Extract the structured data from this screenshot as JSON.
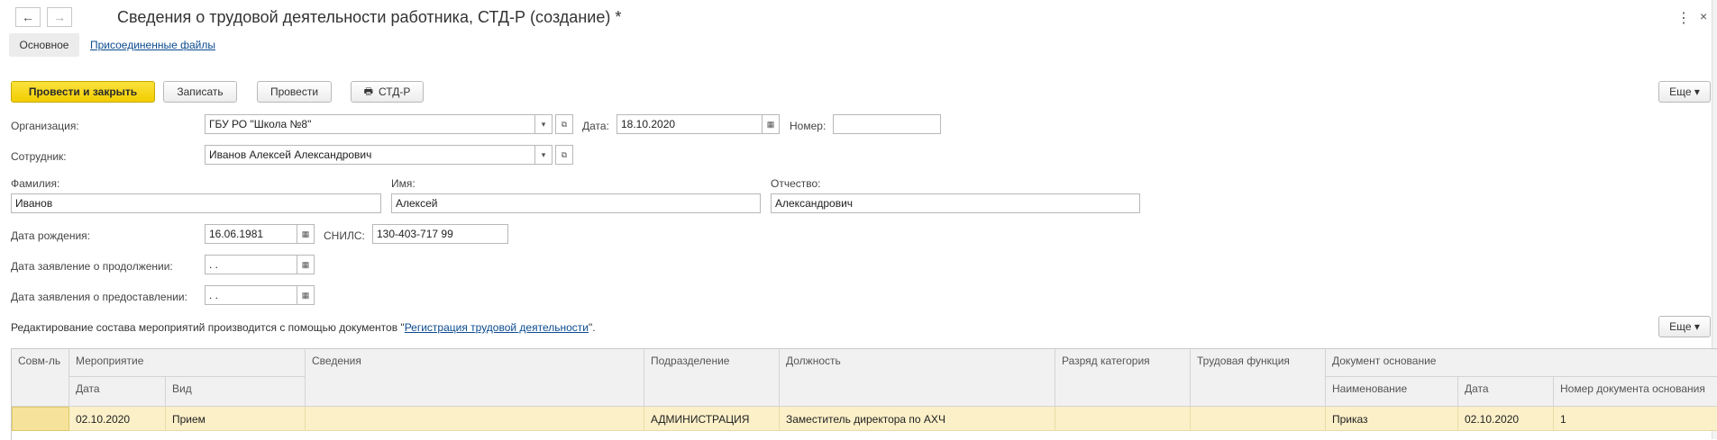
{
  "window": {
    "title": "Сведения о трудовой деятельности работника, СТД-Р (создание) *",
    "nav_back": "←",
    "nav_forward": "→",
    "menu_icon": "⋮",
    "close_icon": "×"
  },
  "tabs": {
    "main": "Основное",
    "attached": "Присоединенные файлы"
  },
  "toolbar": {
    "post_close": "Провести и закрыть",
    "save": "Записать",
    "post": "Провести",
    "print_icon": "🖶",
    "std_r": "СТД-Р",
    "more": "Еще ▾"
  },
  "form": {
    "organization_label": "Организация:",
    "organization_value": "ГБУ РО \"Школа №8\"",
    "date_label": "Дата:",
    "date_value": "18.10.2020",
    "number_label": "Номер:",
    "number_value": "",
    "employee_label": "Сотрудник:",
    "employee_value": "Иванов Алексей Александрович",
    "lastname_label": "Фамилия:",
    "lastname_value": "Иванов",
    "firstname_label": "Имя:",
    "firstname_value": "Алексей",
    "patronymic_label": "Отчество:",
    "patronymic_value": "Александрович",
    "birthdate_label": "Дата рождения:",
    "birthdate_value": "16.06.1981",
    "snils_label": "СНИЛС:",
    "snils_value": "130-403-717 99",
    "continue_label": "Дата заявление о продолжении:",
    "continue_value": " .  .",
    "provide_label": "Дата заявления о предоставлении:",
    "provide_value": " .  .",
    "dropdown_icon": "▾",
    "open_icon": "⧉",
    "calendar_icon": "▦"
  },
  "info": {
    "text": "Редактирование состава мероприятий производится с помощью документов \"",
    "link": "Регистрация трудовой деятельности",
    "suffix": "\".",
    "more": "Еще ▾"
  },
  "table": {
    "headers": {
      "sovm": "Совм-ль",
      "event": "Мероприятие",
      "event_date": "Дата",
      "event_kind": "Вид",
      "details": "Сведения",
      "department": "Подразделение",
      "position": "Должность",
      "grade": "Разряд категория",
      "function": "Трудовая функция",
      "doc_basis": "Документ основание",
      "doc_name": "Наименование",
      "doc_date": "Дата",
      "doc_number": "Номер документа основания"
    },
    "rows": [
      {
        "sovm": "",
        "event_date": "02.10.2020",
        "event_kind": "Прием",
        "details": "",
        "department": "АДМИНИСТРАЦИЯ",
        "position": "Заместитель директора по АХЧ",
        "grade": "",
        "function": "",
        "doc_name": "Приказ",
        "doc_date": "02.10.2020",
        "doc_number": "1"
      }
    ]
  }
}
